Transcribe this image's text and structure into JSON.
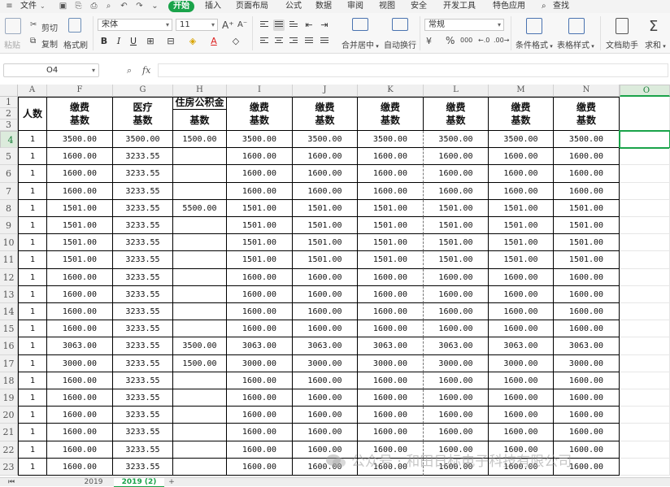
{
  "menu": {
    "file": "文件",
    "tabs": [
      "开始",
      "插入",
      "页面布局",
      "公式",
      "数据",
      "审阅",
      "视图",
      "安全",
      "开发工具",
      "特色应用"
    ],
    "active_tab": "开始",
    "search": "查找"
  },
  "ribbon": {
    "paste": "粘贴",
    "cut": "剪切",
    "copy": "复制",
    "format_painter": "格式刷",
    "font_name": "宋体",
    "font_size": "11",
    "bold": "B",
    "italic": "I",
    "underline": "U",
    "merge_center": "合并居中",
    "wrap_text": "自动换行",
    "number_format": "常规",
    "percent": "%",
    "thousands": "000",
    "conditional_format": "条件格式",
    "table_style": "表格样式",
    "doc_assistant": "文档助手",
    "sum": "求和"
  },
  "formula_bar": {
    "name_box": "O4",
    "fx": "fx",
    "formula": ""
  },
  "grid": {
    "columns": [
      "A",
      "F",
      "G",
      "H",
      "I",
      "J",
      "K",
      "L",
      "M",
      "N",
      "O"
    ],
    "selected_column": "O",
    "selected_row": "4",
    "header_rows": [
      "1",
      "2",
      "3"
    ],
    "headers": {
      "A": "人数",
      "F": [
        "缴费",
        "基数"
      ],
      "G": [
        "医疗",
        "基数"
      ],
      "H": [
        "住房公积金",
        "基数"
      ],
      "I": [
        "缴费",
        "基数"
      ],
      "J": [
        "缴费",
        "基数"
      ],
      "K": [
        "缴费",
        "基数"
      ],
      "L": [
        "缴费",
        "基数"
      ],
      "M": [
        "缴费",
        "基数"
      ],
      "N": [
        "缴费",
        "基数"
      ]
    },
    "rows": [
      {
        "n": "4",
        "A": "1",
        "F": "3500.00",
        "G": "3500.00",
        "H": "1500.00",
        "v": "3500.00"
      },
      {
        "n": "5",
        "A": "1",
        "F": "1600.00",
        "G": "3233.55",
        "H": "",
        "v": "1600.00"
      },
      {
        "n": "6",
        "A": "1",
        "F": "1600.00",
        "G": "3233.55",
        "H": "",
        "v": "1600.00"
      },
      {
        "n": "7",
        "A": "1",
        "F": "1600.00",
        "G": "3233.55",
        "H": "",
        "v": "1600.00"
      },
      {
        "n": "8",
        "A": "1",
        "F": "1501.00",
        "G": "3233.55",
        "H": "5500.00",
        "v": "1501.00"
      },
      {
        "n": "9",
        "A": "1",
        "F": "1501.00",
        "G": "3233.55",
        "H": "",
        "v": "1501.00"
      },
      {
        "n": "10",
        "A": "1",
        "F": "1501.00",
        "G": "3233.55",
        "H": "",
        "v": "1501.00"
      },
      {
        "n": "11",
        "A": "1",
        "F": "1501.00",
        "G": "3233.55",
        "H": "",
        "v": "1501.00"
      },
      {
        "n": "12",
        "A": "1",
        "F": "1600.00",
        "G": "3233.55",
        "H": "",
        "v": "1600.00"
      },
      {
        "n": "13",
        "A": "1",
        "F": "1600.00",
        "G": "3233.55",
        "H": "",
        "v": "1600.00"
      },
      {
        "n": "14",
        "A": "1",
        "F": "1600.00",
        "G": "3233.55",
        "H": "",
        "v": "1600.00"
      },
      {
        "n": "15",
        "A": "1",
        "F": "1600.00",
        "G": "3233.55",
        "H": "",
        "v": "1600.00"
      },
      {
        "n": "16",
        "A": "1",
        "F": "3063.00",
        "G": "3233.55",
        "H": "3500.00",
        "v": "3063.00"
      },
      {
        "n": "17",
        "A": "1",
        "F": "3000.00",
        "G": "3233.55",
        "H": "1500.00",
        "v": "3000.00"
      },
      {
        "n": "18",
        "A": "1",
        "F": "1600.00",
        "G": "3233.55",
        "H": "",
        "v": "1600.00"
      },
      {
        "n": "19",
        "A": "1",
        "F": "1600.00",
        "G": "3233.55",
        "H": "",
        "v": "1600.00"
      },
      {
        "n": "20",
        "A": "1",
        "F": "1600.00",
        "G": "3233.55",
        "H": "",
        "v": "1600.00"
      },
      {
        "n": "21",
        "A": "1",
        "F": "1600.00",
        "G": "3233.55",
        "H": "",
        "v": "1600.00"
      },
      {
        "n": "22",
        "A": "1",
        "F": "1600.00",
        "G": "3233.55",
        "H": "",
        "v": "1600.00"
      },
      {
        "n": "23",
        "A": "1",
        "F": "1600.00",
        "G": "3233.55",
        "H": "",
        "v": "1600.00"
      }
    ]
  },
  "sheets": [
    "2019",
    "2019 (2)"
  ],
  "active_sheet": "2019 (2)",
  "add_sheet": "+",
  "watermark": "公众号 · 和田日标电子科技有限公司",
  "colors": {
    "accent": "#1aa34a",
    "grid_border": "#000000"
  }
}
